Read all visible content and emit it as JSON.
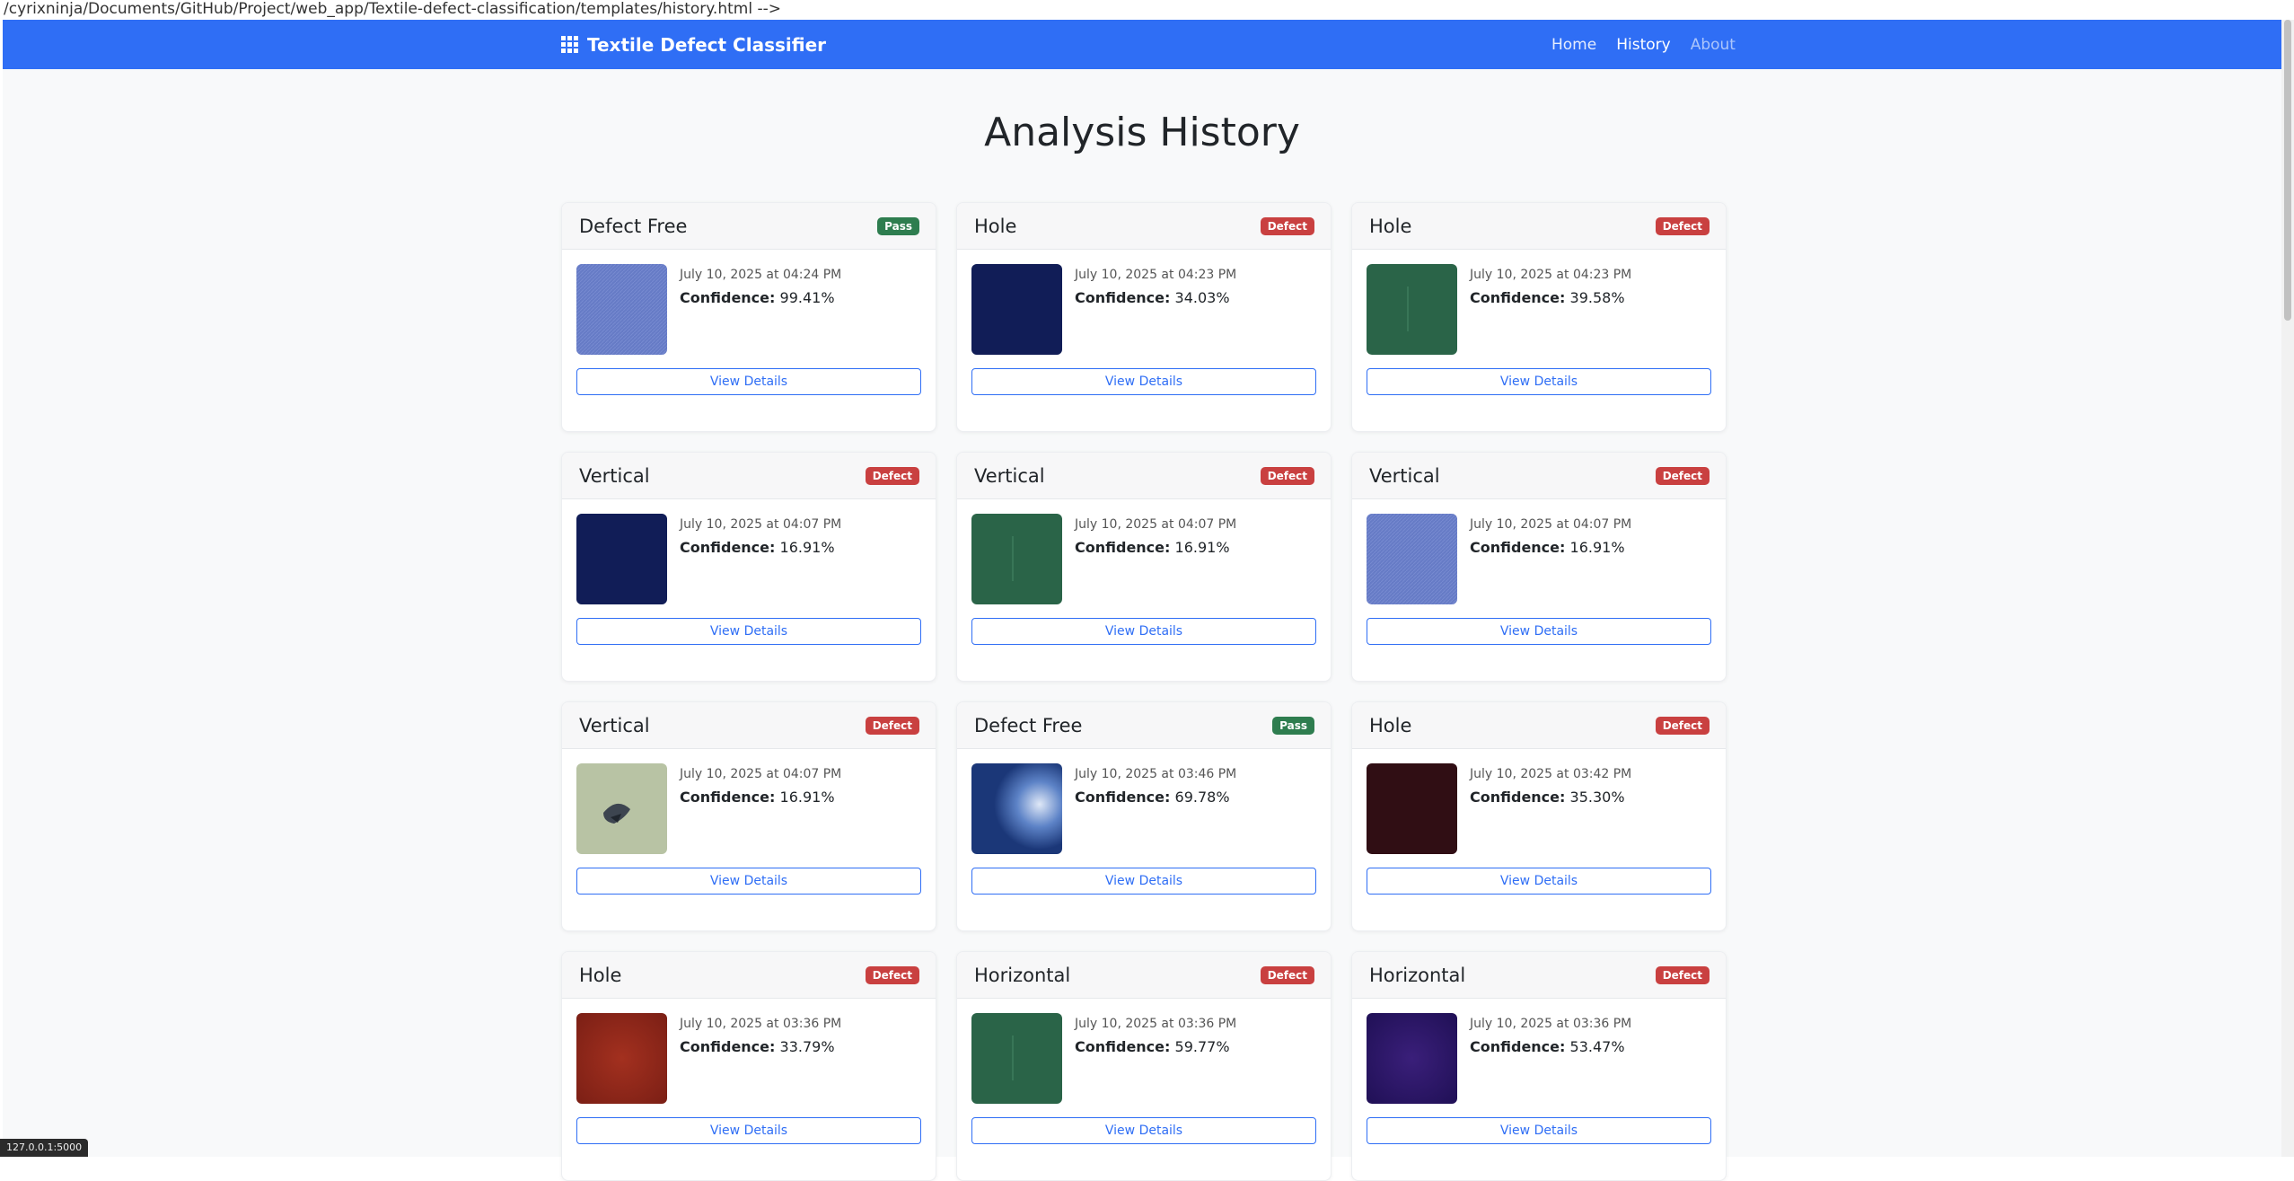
{
  "source_comment": "/cyrixninja/Documents/GitHub/Project/web_app/Textile-defect-classification/templates/history.html -->",
  "navbar": {
    "brand": "Textile Defect Classifier",
    "links": [
      {
        "label": "Home"
      },
      {
        "label": "History"
      },
      {
        "label": "About"
      }
    ]
  },
  "page_title": "Analysis History",
  "button_label": "View Details",
  "confidence_label": "Confidence:",
  "cards": [
    {
      "title": "Defect Free",
      "badge": "Pass",
      "date": "July 10, 2025 at 04:24 PM",
      "confidence": "99.41%",
      "thumb": "blue-denim"
    },
    {
      "title": "Hole",
      "badge": "Defect",
      "date": "July 10, 2025 at 04:23 PM",
      "confidence": "34.03%",
      "thumb": "navy"
    },
    {
      "title": "Hole",
      "badge": "Defect",
      "date": "July 10, 2025 at 04:23 PM",
      "confidence": "39.58%",
      "thumb": "green"
    },
    {
      "title": "Vertical",
      "badge": "Defect",
      "date": "July 10, 2025 at 04:07 PM",
      "confidence": "16.91%",
      "thumb": "navy"
    },
    {
      "title": "Vertical",
      "badge": "Defect",
      "date": "July 10, 2025 at 04:07 PM",
      "confidence": "16.91%",
      "thumb": "green"
    },
    {
      "title": "Vertical",
      "badge": "Defect",
      "date": "July 10, 2025 at 04:07 PM",
      "confidence": "16.91%",
      "thumb": "blue-denim"
    },
    {
      "title": "Vertical",
      "badge": "Defect",
      "date": "July 10, 2025 at 04:07 PM",
      "confidence": "16.91%",
      "thumb": "sage-hole"
    },
    {
      "title": "Defect Free",
      "badge": "Pass",
      "date": "July 10, 2025 at 03:46 PM",
      "confidence": "69.78%",
      "thumb": "denim-glow"
    },
    {
      "title": "Hole",
      "badge": "Defect",
      "date": "July 10, 2025 at 03:42 PM",
      "confidence": "35.30%",
      "thumb": "dark-maroon"
    },
    {
      "title": "Hole",
      "badge": "Defect",
      "date": "July 10, 2025 at 03:36 PM",
      "confidence": "33.79%",
      "thumb": "red"
    },
    {
      "title": "Horizontal",
      "badge": "Defect",
      "date": "July 10, 2025 at 03:36 PM",
      "confidence": "59.77%",
      "thumb": "green"
    },
    {
      "title": "Horizontal",
      "badge": "Defect",
      "date": "July 10, 2025 at 03:36 PM",
      "confidence": "53.47%",
      "thumb": "purple"
    }
  ],
  "status_url": "127.0.0.1:5000",
  "colors": {
    "accent": "#2f6ef5",
    "pass": "#2e7d4f",
    "defect": "#c94040"
  }
}
